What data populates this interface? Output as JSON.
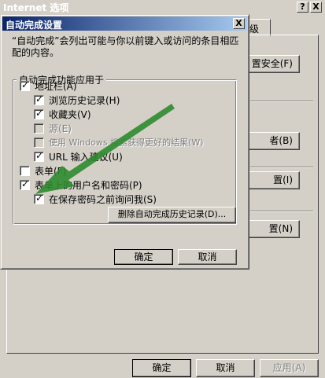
{
  "outer_window": {
    "title": "Internet 选项",
    "help_button": "?",
    "close_button": "X",
    "tab_visible_label": "级",
    "side_buttons": [
      "置安全(F)",
      "者(B)",
      "置(I)",
      "置(N)"
    ],
    "footer": {
      "ok": "确定",
      "cancel": "取消",
      "apply": "应用(A)"
    }
  },
  "dialog": {
    "title": "自动完成设置",
    "close_button": "X",
    "description": "“自动完成”会列出可能与你以前键入或访问的条目相匹配的内容。",
    "group_label": "自动完成功能应用于",
    "options": [
      {
        "label": "地址栏(A)",
        "checked": true,
        "enabled": true
      },
      {
        "label": "浏览历史记录(H)",
        "checked": true,
        "enabled": true
      },
      {
        "label": "收藏夹(V)",
        "checked": true,
        "enabled": true
      },
      {
        "label": "源(E)",
        "checked": false,
        "enabled": false
      },
      {
        "label": "使用 Windows 搜索获得更好的结果(W)",
        "checked": false,
        "enabled": false
      },
      {
        "label": "URL 输入建议(U)",
        "checked": true,
        "enabled": true
      },
      {
        "label": "表单(F)",
        "checked": false,
        "enabled": true
      },
      {
        "label": "表单上的用户名和密码(P)",
        "checked": true,
        "enabled": true
      },
      {
        "label": "在保存密码之前询问我(S)",
        "checked": true,
        "enabled": true
      }
    ],
    "delete_history_button": "删除自动完成历史记录(D)...",
    "ok": "确定",
    "cancel": "取消"
  },
  "annotation": {
    "arrow_color": "#2e8b2e"
  }
}
